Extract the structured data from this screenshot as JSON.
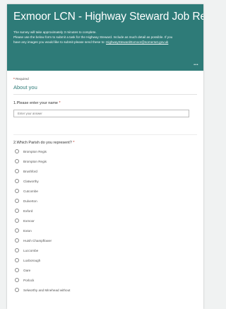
{
  "form": {
    "title": "Exmoor LCN - Highway Steward Job Request",
    "description": [
      "The survey will take approximately 3 minutes to complete.",
      "Please use the below form to submit a task for the Highway Steward. Include as much detail as possible. If you"
    ],
    "description_line3_prefix": "have any images you would like to submit please send these to:",
    "email": "HighwayStewardExmoor@somerset.gov.uk",
    "more_icon": "ellipsis-icon",
    "required_marker": "*",
    "required_label": "Required",
    "section_title": "About you",
    "accent_color": "#2e7b78"
  },
  "q1": {
    "number": "1.",
    "label": "Please enter your name",
    "star": "*",
    "placeholder": "Enter your answer"
  },
  "q2": {
    "number": "2.",
    "label": "Which Parish do you represent?",
    "star": "*",
    "options": [
      "Brompton Regis",
      "Brompton Regis",
      "Brushford",
      "Clatworthy",
      "Cutcombe",
      "Dulverton",
      "Exford",
      "Exmoor",
      "Exton",
      "Huish Champflower",
      "Luccombe",
      "Luxborough",
      "Oare",
      "Porlock",
      "Selworthy and Minehead without"
    ]
  }
}
